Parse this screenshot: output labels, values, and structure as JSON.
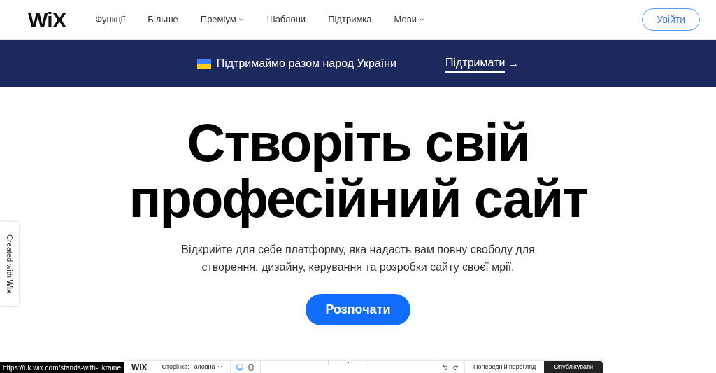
{
  "header": {
    "logo": "WiX",
    "nav": [
      {
        "label": "Функції",
        "dropdown": false
      },
      {
        "label": "Більше",
        "dropdown": false
      },
      {
        "label": "Преміум",
        "dropdown": true
      },
      {
        "label": "Шаблони",
        "dropdown": false
      },
      {
        "label": "Підтримка",
        "dropdown": false
      },
      {
        "label": "Мови",
        "dropdown": true
      }
    ],
    "login_button": "Увійти"
  },
  "banner": {
    "text": "Підтримаймо разом народ України",
    "link": "Підтримати",
    "arrow": "→"
  },
  "hero": {
    "title_lines": [
      "Створіть свій",
      "професійний сайт"
    ],
    "subtitle": "Відкрийте для себе платформу, яка надасть вам повну свободу для створення, дизайну, керування та розробки сайту своєї мрії.",
    "cta": "Розпочати"
  },
  "side_tab": {
    "text": "Created with",
    "brand": "Wix"
  },
  "editor_bar": {
    "logo": "WiX",
    "page_select": "Сторінка: Головна",
    "preview": "Попередній перегляд",
    "publish": "Опублікувати"
  },
  "status_url": "https://uk.wix.com/stands-with-ukraine"
}
